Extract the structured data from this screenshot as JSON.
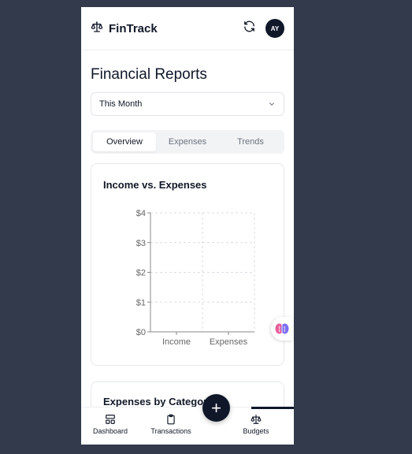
{
  "header": {
    "app_title": "FinTrack",
    "avatar_initials": "AY"
  },
  "page_title": "Financial Reports",
  "period_select": {
    "value": "This Month"
  },
  "tabs": [
    {
      "label": "Overview",
      "active": true
    },
    {
      "label": "Expenses",
      "active": false
    },
    {
      "label": "Trends",
      "active": false
    }
  ],
  "income_card": {
    "title": "Income vs. Expenses"
  },
  "expenses_card": {
    "title": "Expenses by Category"
  },
  "chart_data": {
    "type": "bar",
    "title": "Income vs. Expenses",
    "categories": [
      "Income",
      "Expenses"
    ],
    "values": [
      0,
      0
    ],
    "yticks": [
      "$0",
      "$1",
      "$2",
      "$3",
      "$4"
    ],
    "ylim": [
      0,
      4
    ],
    "grid": true
  },
  "bottom_nav": {
    "items": [
      {
        "label": "Dashboard",
        "icon": "dashboard-icon"
      },
      {
        "label": "Transactions",
        "icon": "clipboard-icon"
      },
      {
        "label": "Budgets",
        "icon": "scale-icon",
        "active": true
      }
    ],
    "fab_icon": "plus-icon"
  },
  "colors": {
    "accent": "#0f1729",
    "background": "#323a4b"
  }
}
